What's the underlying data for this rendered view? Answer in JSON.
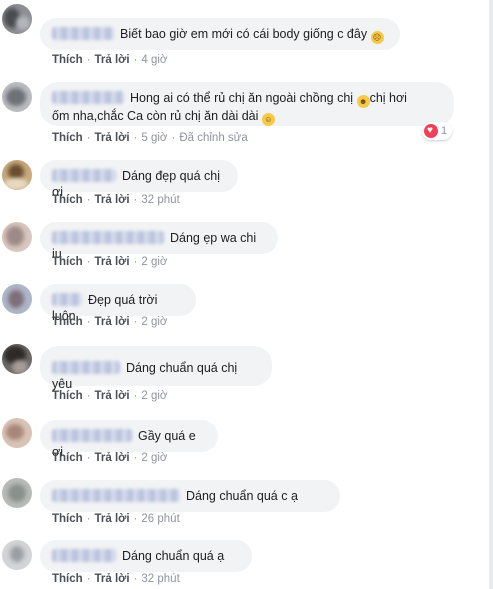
{
  "ui": {
    "like_label": "Thích",
    "reply_label": "Trả lời",
    "separator": "·"
  },
  "comments": [
    {
      "text": "Biết bao giờ em mới có cái body giống c đây",
      "emoji": "disappointed-face",
      "time": "4 giờ"
    },
    {
      "text_line1": "Hong ai có thể rủ chị ăn ngoài chồng chị",
      "emoji1": "grinning-squinting-face",
      "text_line1b": "chị hơi",
      "text_line2": "ốm nha,chắc Ca còn rủ chị ăn dài dài",
      "emoji2": "smiling-face",
      "time": "5 giờ",
      "edited": "Đã chỉnh sửa",
      "reaction": {
        "type": "love",
        "count": "1"
      }
    },
    {
      "text": "Dáng đẹp quá chị ơi",
      "time": "32 phút"
    },
    {
      "text": "Dáng ẹp wa chi iu",
      "time": "2 giờ"
    },
    {
      "text": "Đẹp quá trời luôn",
      "time": "2 giờ"
    },
    {
      "text": "Dáng chuẩn quá chị yêu",
      "time": "2 giờ"
    },
    {
      "text": "Gầy quá e ơi",
      "time": "2 giờ"
    },
    {
      "text": "Dáng chuẩn quá c ạ",
      "time": "26 phút"
    },
    {
      "text": "Dáng chuẩn quá ạ",
      "time": "32 phút"
    }
  ]
}
